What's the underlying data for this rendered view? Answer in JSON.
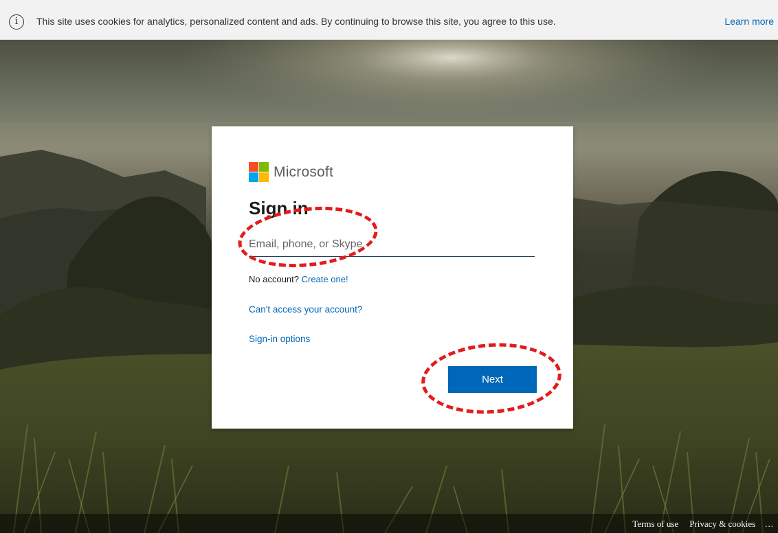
{
  "cookie_banner": {
    "icon": "info-icon",
    "text": "This site uses cookies for analytics, personalized content and ads. By continuing to browse this site, you agree to this use.",
    "learn_more": "Learn more"
  },
  "brand": {
    "name": "Microsoft",
    "logo_colors": [
      "#f25022",
      "#7fba00",
      "#00a4ef",
      "#ffb900"
    ]
  },
  "signin": {
    "title": "Sign in",
    "email_placeholder": "Email, phone, or Skype",
    "email_value": "",
    "no_account_text": "No account?",
    "create_link": "Create one!",
    "cant_access": "Can't access your account?",
    "signin_options": "Sign-in options",
    "next_label": "Next"
  },
  "footer": {
    "terms": "Terms of use",
    "privacy": "Privacy & cookies",
    "more": "..."
  },
  "colors": {
    "accent": "#0067b8",
    "annotation": "#e31b1b"
  }
}
